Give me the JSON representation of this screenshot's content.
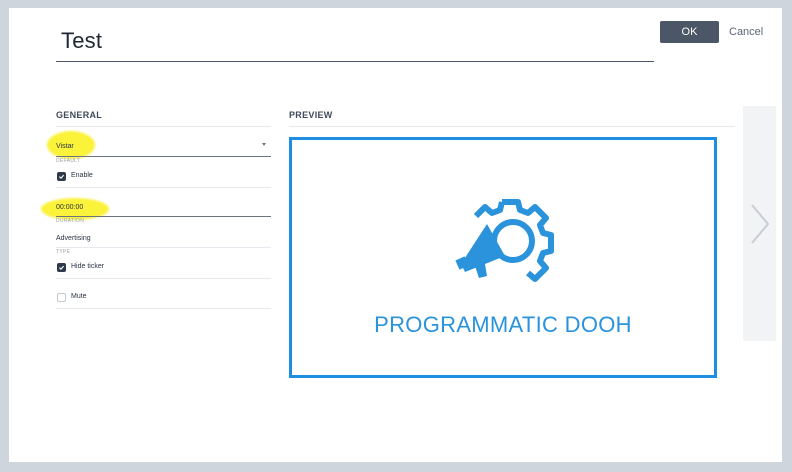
{
  "dialog": {
    "title": "Test",
    "ok_label": "OK",
    "cancel_label": "Cancel"
  },
  "general": {
    "heading": "GENERAL",
    "default_value": "Vistar",
    "default_label": "DEFAULT",
    "enable_label": "Enable",
    "enable_checked": true,
    "duration_value": "00:00:00",
    "duration_label": "DURATION",
    "type_value": "Advertising",
    "type_label": "TYPE",
    "hide_ticker_label": "Hide ticker",
    "hide_ticker_checked": true,
    "mute_label": "Mute",
    "mute_checked": false
  },
  "preview": {
    "heading": "PREVIEW",
    "brand_text": "PROGRAMMATIC DOOH",
    "border_color": "#1e8ee0",
    "icon": "megaphone-gear-icon"
  },
  "colors": {
    "accent": "#2a93dc",
    "ok_button": "#4b5666",
    "highlight": "#fbf23a"
  },
  "icons": {
    "next": "chevron-right-icon",
    "dropdown": "caret-down-icon",
    "check": "check-icon"
  }
}
